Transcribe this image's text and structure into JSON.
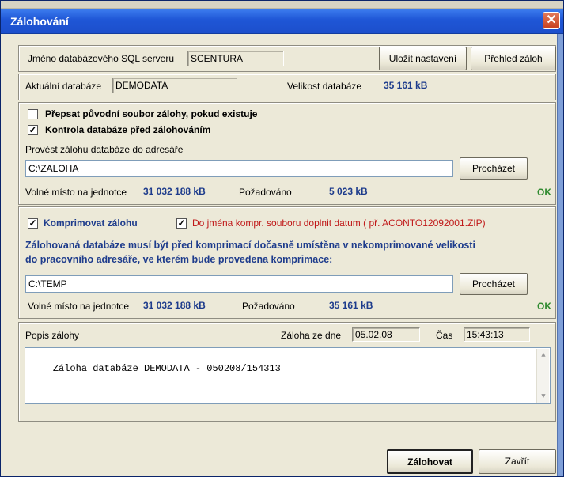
{
  "window": {
    "title": "Zálohování",
    "close_symbol": "✕"
  },
  "server": {
    "label": "Jméno databázového SQL serveru",
    "value": "SCENTURA"
  },
  "buttons": {
    "save_settings": "Uložit nastavení",
    "backups_overview": "Přehled záloh",
    "browse1": "Procházet",
    "browse2": "Procházet",
    "backup": "Zálohovat",
    "close": "Zavřít"
  },
  "database": {
    "label": "Aktuální databáze",
    "value": "DEMODATA",
    "size_label": "Velikost databáze",
    "size_value": "35 161 kB"
  },
  "options": {
    "overwrite": {
      "label": "Přepsat původní soubor zálohy, pokud existuje",
      "checked": false
    },
    "check_db": {
      "label": "Kontrola databáze před zálohováním",
      "checked": true
    }
  },
  "target": {
    "label": "Provést zálohu databáze do adresáře",
    "path": "C:\\ZALOHA",
    "free_label": "Volné místo na jednotce",
    "free_value": "31  032 188 kB",
    "required_label": "Požadováno",
    "required_value": "5 023 kB",
    "status": "OK"
  },
  "compress": {
    "label": "Komprimovat zálohu",
    "checked": true,
    "date_label": "Do jména kompr. souboru doplnit datum ( př. ACONTO12092001.ZIP)",
    "date_checked": true,
    "note_line1": "Zálohovaná databáze musí být před komprimací dočasně umístěna v nekomprimované velikosti",
    "note_line2": "do pracovního adresáře, ve kterém bude provedena komprimace:",
    "path": "C:\\TEMP",
    "free_label": "Volné místo na jednotce",
    "free_value": "31  032 188 kB",
    "required_label": "Požadováno",
    "required_value": "35 161 kB",
    "status": "OK"
  },
  "description": {
    "label": "Popis zálohy",
    "date_label": "Záloha ze dne",
    "date_value": "05.02.08",
    "time_label": "Čas",
    "time_value": "15:43:13",
    "text": "Záloha databáze DEMODATA - 050208/154313"
  },
  "icons": {
    "check": "✓",
    "up": "▲",
    "down": "▼"
  },
  "colors": {
    "title_bar": "#1f56d6",
    "accent_blue": "#1e3c8c",
    "ok_green": "#2f8a2f",
    "red_text": "#c01818"
  }
}
